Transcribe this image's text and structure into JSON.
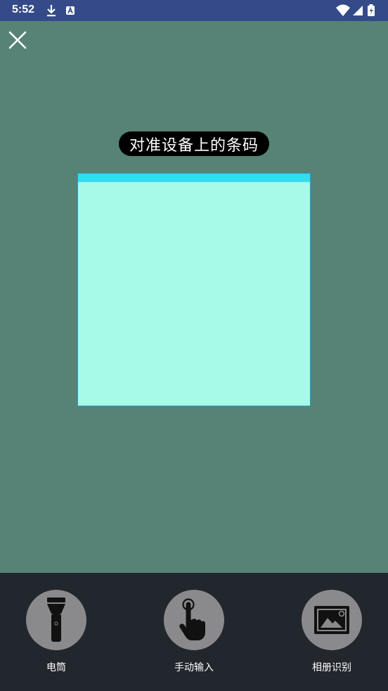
{
  "status_bar": {
    "time": "5:52",
    "icons": [
      "download-icon",
      "a-notification-icon",
      "wifi-icon",
      "signal-icon",
      "battery-charging-icon"
    ]
  },
  "scanner": {
    "hint": "对准设备上的条码",
    "close_icon": "close-icon"
  },
  "actions": [
    {
      "label": "电筒",
      "icon": "flashlight-icon"
    },
    {
      "label": "手动输入",
      "icon": "touch-hand-icon"
    },
    {
      "label": "相册识别",
      "icon": "image-icon"
    }
  ],
  "colors": {
    "status_bar_bg": "#354a88",
    "camera_overlay_bg": "#568376",
    "scan_area": "#a5fbe8",
    "scan_line": "#33ddef",
    "bottom_bar_bg": "#22262d",
    "action_circle": "#8a8a8c"
  }
}
